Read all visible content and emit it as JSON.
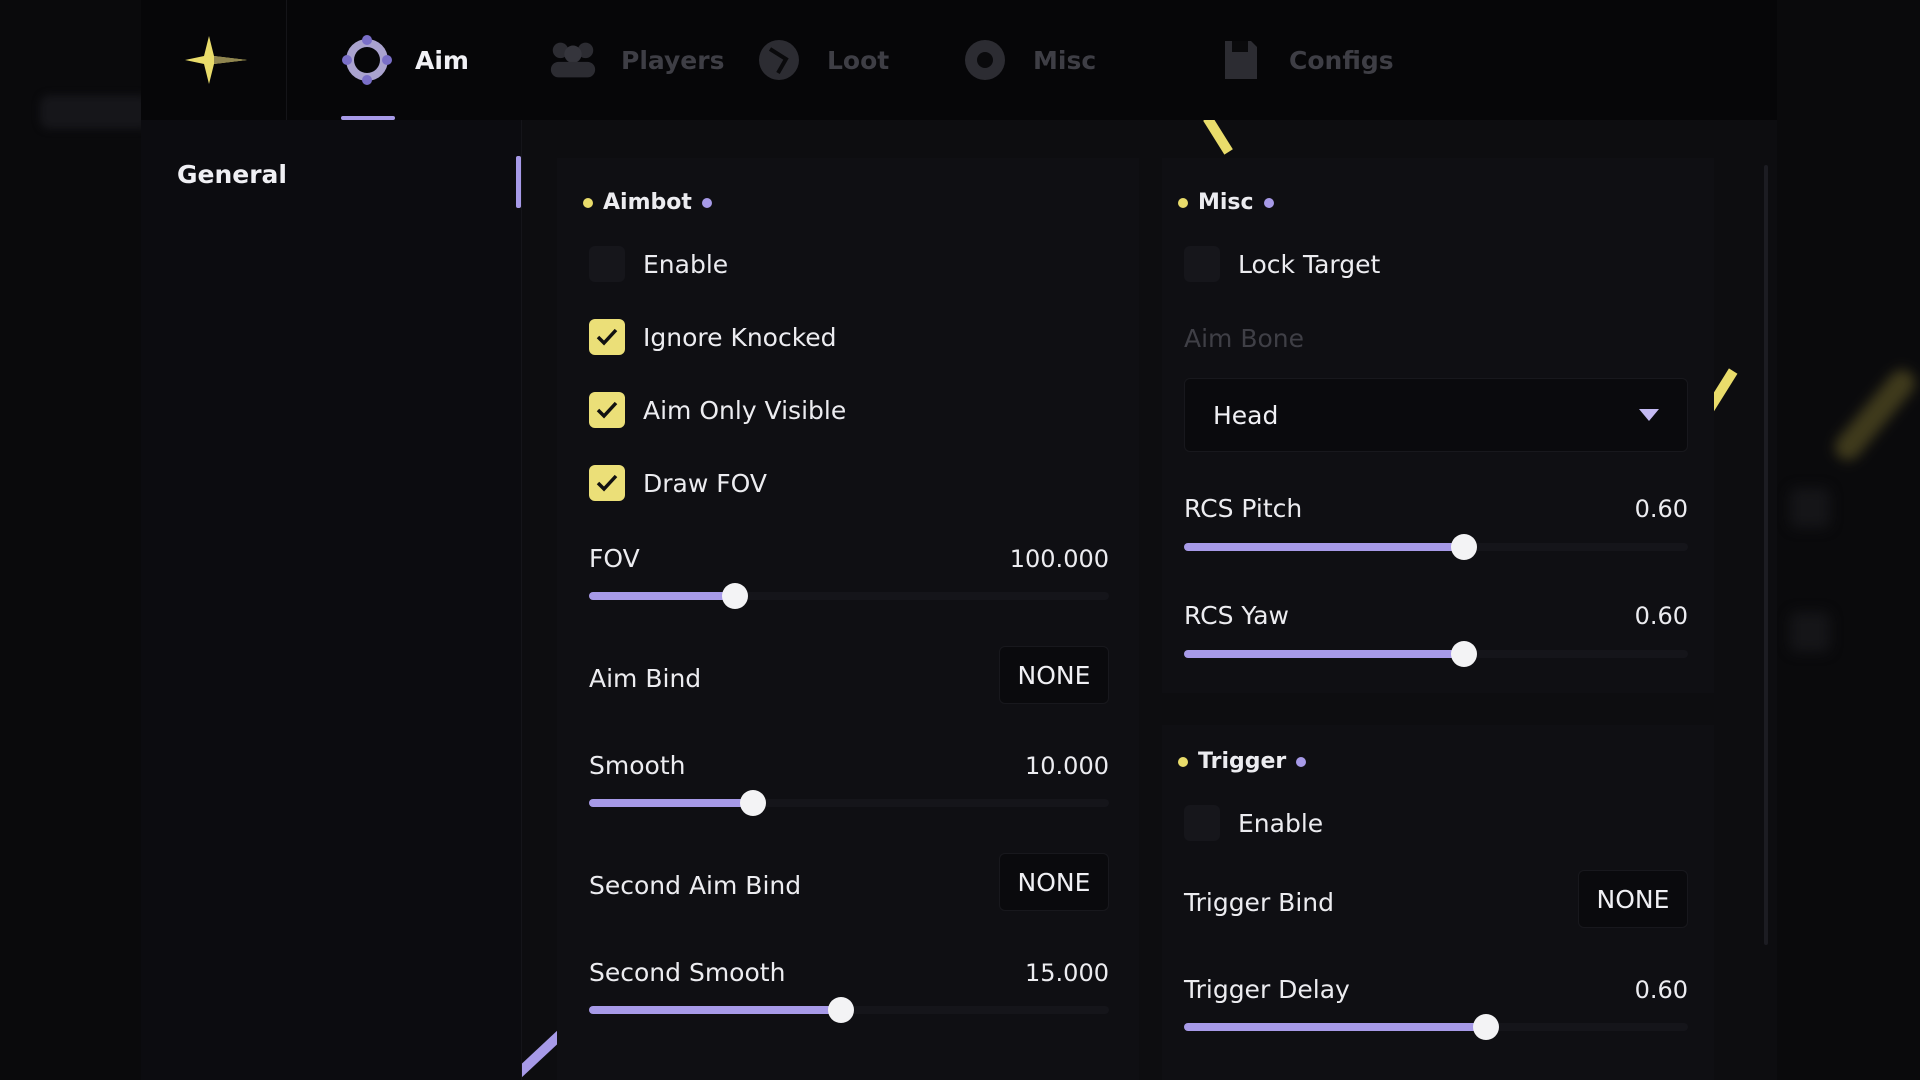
{
  "tabs": [
    {
      "label": "Aim",
      "icon": "crosshair-icon",
      "active": true
    },
    {
      "label": "Players",
      "icon": "players-icon",
      "active": false
    },
    {
      "label": "Loot",
      "icon": "loot-icon",
      "active": false
    },
    {
      "label": "Misc",
      "icon": "gear-icon",
      "active": false
    },
    {
      "label": "Configs",
      "icon": "save-icon",
      "active": false
    }
  ],
  "sidebar": {
    "items": [
      {
        "label": "General"
      }
    ]
  },
  "aimbot": {
    "title": "Aimbot",
    "checkboxes": [
      {
        "label": "Enable",
        "checked": false
      },
      {
        "label": "Ignore Knocked",
        "checked": true
      },
      {
        "label": "Aim Only Visible",
        "checked": true
      },
      {
        "label": "Draw FOV",
        "checked": true
      }
    ],
    "fov": {
      "label": "FOV",
      "value_text": "100.000",
      "fill_fraction": 0.28
    },
    "aim_bind": {
      "label": "Aim Bind",
      "value": "NONE"
    },
    "smooth": {
      "label": "Smooth",
      "value_text": "10.000",
      "fill_fraction": 0.315
    },
    "second_aim_bind": {
      "label": "Second Aim Bind",
      "value": "NONE"
    },
    "second_smooth": {
      "label": "Second Smooth",
      "value_text": "15.000",
      "fill_fraction": 0.485
    }
  },
  "misc": {
    "title": "Misc",
    "lock_target": {
      "label": "Lock Target",
      "checked": false
    },
    "aim_bone": {
      "label": "Aim Bone",
      "selected": "Head"
    },
    "rcs_pitch": {
      "label": "RCS Pitch",
      "value_text": "0.60",
      "fill_fraction": 0.555
    },
    "rcs_yaw": {
      "label": "RCS Yaw",
      "value_text": "0.60",
      "fill_fraction": 0.555
    }
  },
  "trigger": {
    "title": "Trigger",
    "enable": {
      "label": "Enable",
      "checked": false
    },
    "trigger_bind": {
      "label": "Trigger Bind",
      "value": "NONE"
    },
    "trigger_delay": {
      "label": "Trigger Delay",
      "value_text": "0.60",
      "fill_fraction": 0.6
    }
  },
  "colors": {
    "accent_purple": "#a79ae8",
    "accent_yellow": "#e9dc6b",
    "background": "#0b0b0e"
  }
}
